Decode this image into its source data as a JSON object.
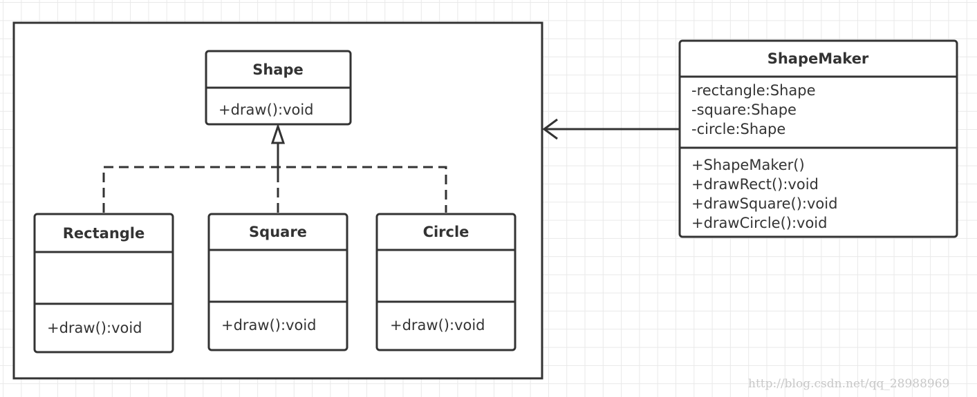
{
  "classes": {
    "shape": {
      "name": "Shape",
      "attributes": [],
      "methods": [
        "+draw():void"
      ]
    },
    "rectangle": {
      "name": "Rectangle",
      "attributes": [],
      "methods": [
        "+draw():void"
      ]
    },
    "square": {
      "name": "Square",
      "attributes": [],
      "methods": [
        "+draw():void"
      ]
    },
    "circle": {
      "name": "Circle",
      "attributes": [],
      "methods": [
        "+draw():void"
      ]
    },
    "shapemaker": {
      "name": "ShapeMaker",
      "attributes": [
        "-rectangle:Shape",
        "-square:Shape",
        "-circle:Shape"
      ],
      "methods": [
        "+ShapeMaker()",
        "+drawRect():void",
        "+drawSquare():void",
        "+drawCircle():void"
      ]
    }
  },
  "relations": [
    {
      "type": "realization",
      "from": "Rectangle",
      "to": "Shape"
    },
    {
      "type": "realization",
      "from": "Square",
      "to": "Shape"
    },
    {
      "type": "realization",
      "from": "Circle",
      "to": "Shape"
    },
    {
      "type": "association",
      "from": "ShapeMaker",
      "to": "shape-package"
    }
  ],
  "colors": {
    "line": "#333333",
    "grid": "#e9e9e9"
  },
  "watermark": "http://blog.csdn.net/qq_28988969"
}
